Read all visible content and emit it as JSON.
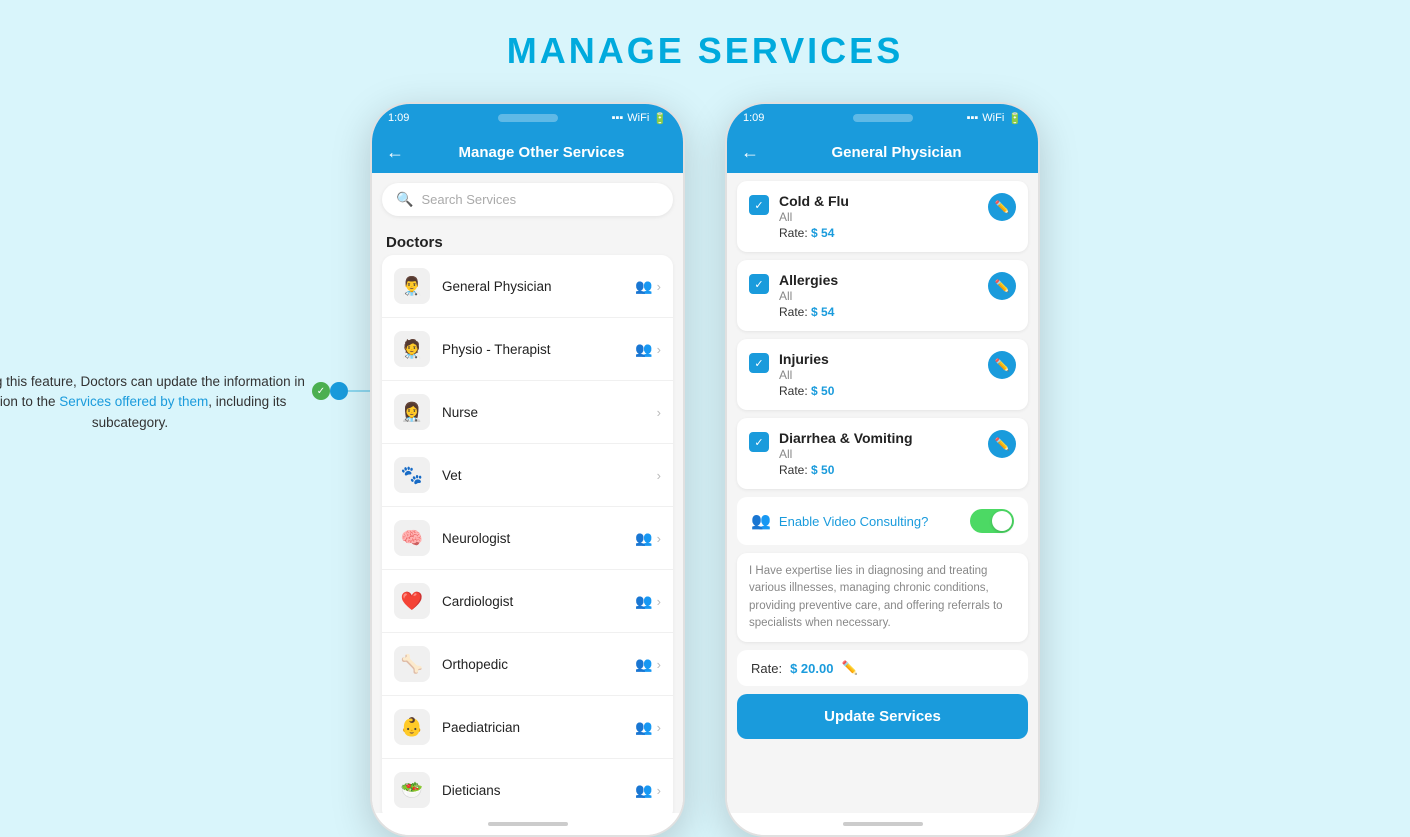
{
  "page": {
    "title": "MANAGE SERVICES"
  },
  "annotation": {
    "text_before_highlight": "Utilizing this feature, Doctors can update the information in relation to the ",
    "highlight_text": "Services offered by them",
    "text_after": ", including its subcategory."
  },
  "phone1": {
    "status_time": "1:09",
    "header_title": "Manage Other Services",
    "search_placeholder": "Search Services",
    "section_label": "Doctors",
    "items": [
      {
        "label": "General Physician",
        "has_people": true,
        "has_chevron": true
      },
      {
        "label": "Physio - Therapist",
        "has_people": true,
        "has_chevron": true
      },
      {
        "label": "Nurse",
        "has_people": false,
        "has_chevron": true
      },
      {
        "label": "Vet",
        "has_people": false,
        "has_chevron": true
      },
      {
        "label": "Neurologist",
        "has_people": true,
        "has_chevron": true
      },
      {
        "label": "Cardiologist",
        "has_people": true,
        "has_chevron": true
      },
      {
        "label": "Orthopedic",
        "has_people": true,
        "has_chevron": true
      },
      {
        "label": "Paediatrician",
        "has_people": true,
        "has_chevron": true
      },
      {
        "label": "Dieticians",
        "has_people": true,
        "has_chevron": true
      }
    ]
  },
  "phone2": {
    "status_time": "1:09",
    "header_title": "General Physician",
    "services": [
      {
        "name": "Cold & Flu",
        "sub": "All",
        "rate": "$ 54",
        "checked": true
      },
      {
        "name": "Allergies",
        "sub": "All",
        "rate": "$ 54",
        "checked": true
      },
      {
        "name": "Injuries",
        "sub": "All",
        "rate": "$ 50",
        "checked": true
      },
      {
        "name": "Diarrhea & Vomiting",
        "sub": "All",
        "rate": "$ 50",
        "checked": true
      }
    ],
    "video_label": "Enable Video Consulting?",
    "description": "I Have expertise lies in diagnosing and treating various illnesses, managing chronic conditions, providing preventive care, and offering referrals to specialists when necessary.",
    "rate_label": "Rate:",
    "rate_value": "$ 20.00",
    "update_btn": "Update Services"
  }
}
